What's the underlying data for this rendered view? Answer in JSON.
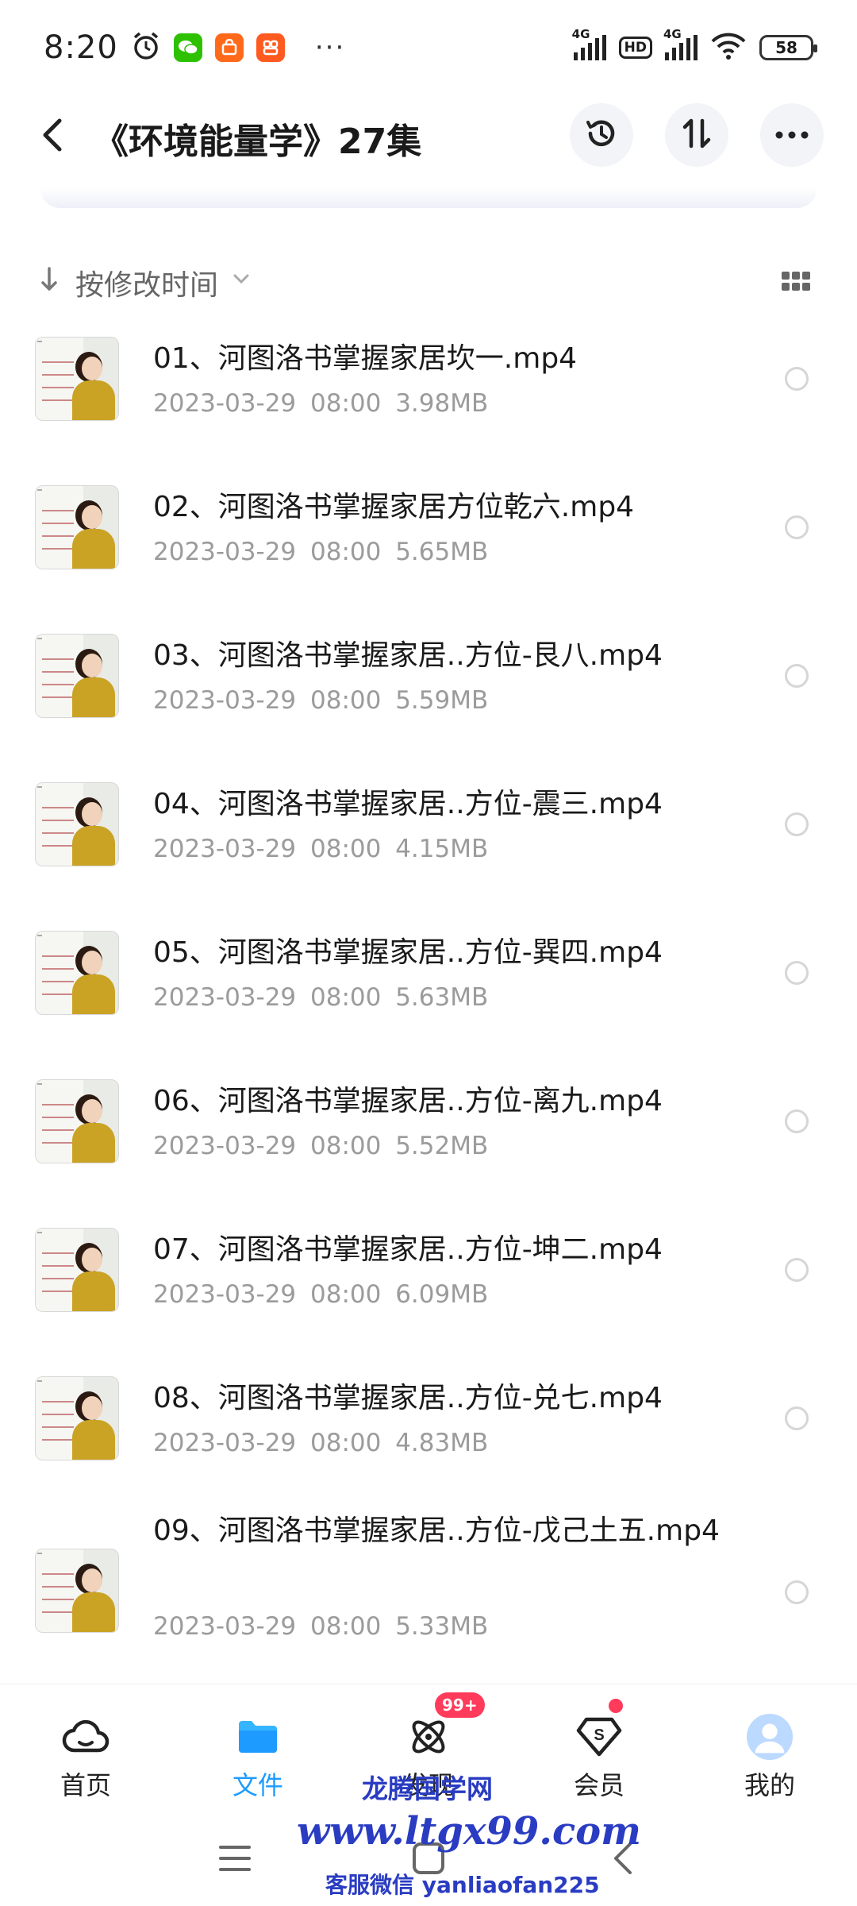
{
  "status_bar": {
    "time": "8:20",
    "icons": [
      "alarm-icon",
      "wechat-icon",
      "shopping-icon",
      "app-icon",
      "more-dots"
    ],
    "more": "···",
    "net1": "4G",
    "hd": "HD",
    "net2": "4G",
    "battery": "58"
  },
  "header": {
    "title": "《环境能量学》27集",
    "buttons": [
      "history-icon",
      "sort-icon",
      "more-icon"
    ]
  },
  "sort": {
    "label": "按修改时间"
  },
  "files": [
    {
      "name": "01、河图洛书掌握家居坎一.mp4",
      "meta": "2023-03-29  08:00  3.98MB"
    },
    {
      "name": "02、河图洛书掌握家居方位乾六.mp4",
      "meta": "2023-03-29  08:00  5.65MB"
    },
    {
      "name": "03、河图洛书掌握家居..方位-艮八.mp4",
      "meta": "2023-03-29  08:00  5.59MB"
    },
    {
      "name": "04、河图洛书掌握家居..方位-震三.mp4",
      "meta": "2023-03-29  08:00  4.15MB"
    },
    {
      "name": "05、河图洛书掌握家居..方位-巽四.mp4",
      "meta": "2023-03-29  08:00  5.63MB"
    },
    {
      "name": "06、河图洛书掌握家居..方位-离九.mp4",
      "meta": "2023-03-29  08:00  5.52MB"
    },
    {
      "name": "07、河图洛书掌握家居..方位-坤二.mp4",
      "meta": "2023-03-29  08:00  6.09MB"
    },
    {
      "name": "08、河图洛书掌握家居..方位-兑七.mp4",
      "meta": "2023-03-29  08:00  4.83MB"
    },
    {
      "name": "09、河图洛书掌握家居..方位-戊己土五.mp4",
      "meta": "2023-03-29  08:00  5.33MB"
    }
  ],
  "bottom_nav": {
    "home": "首页",
    "files": "文件",
    "discover": "发现",
    "discover_badge": "99+",
    "vip": "会员",
    "me": "我的"
  },
  "watermark": {
    "line1": "龙腾国学网",
    "line2": "www.ltgx99.com",
    "line3": "客服微信 yanliaofan225"
  },
  "colors": {
    "accent": "#1e9bff",
    "badge": "#ff3b5c",
    "watermark": "#2a3cc2"
  }
}
